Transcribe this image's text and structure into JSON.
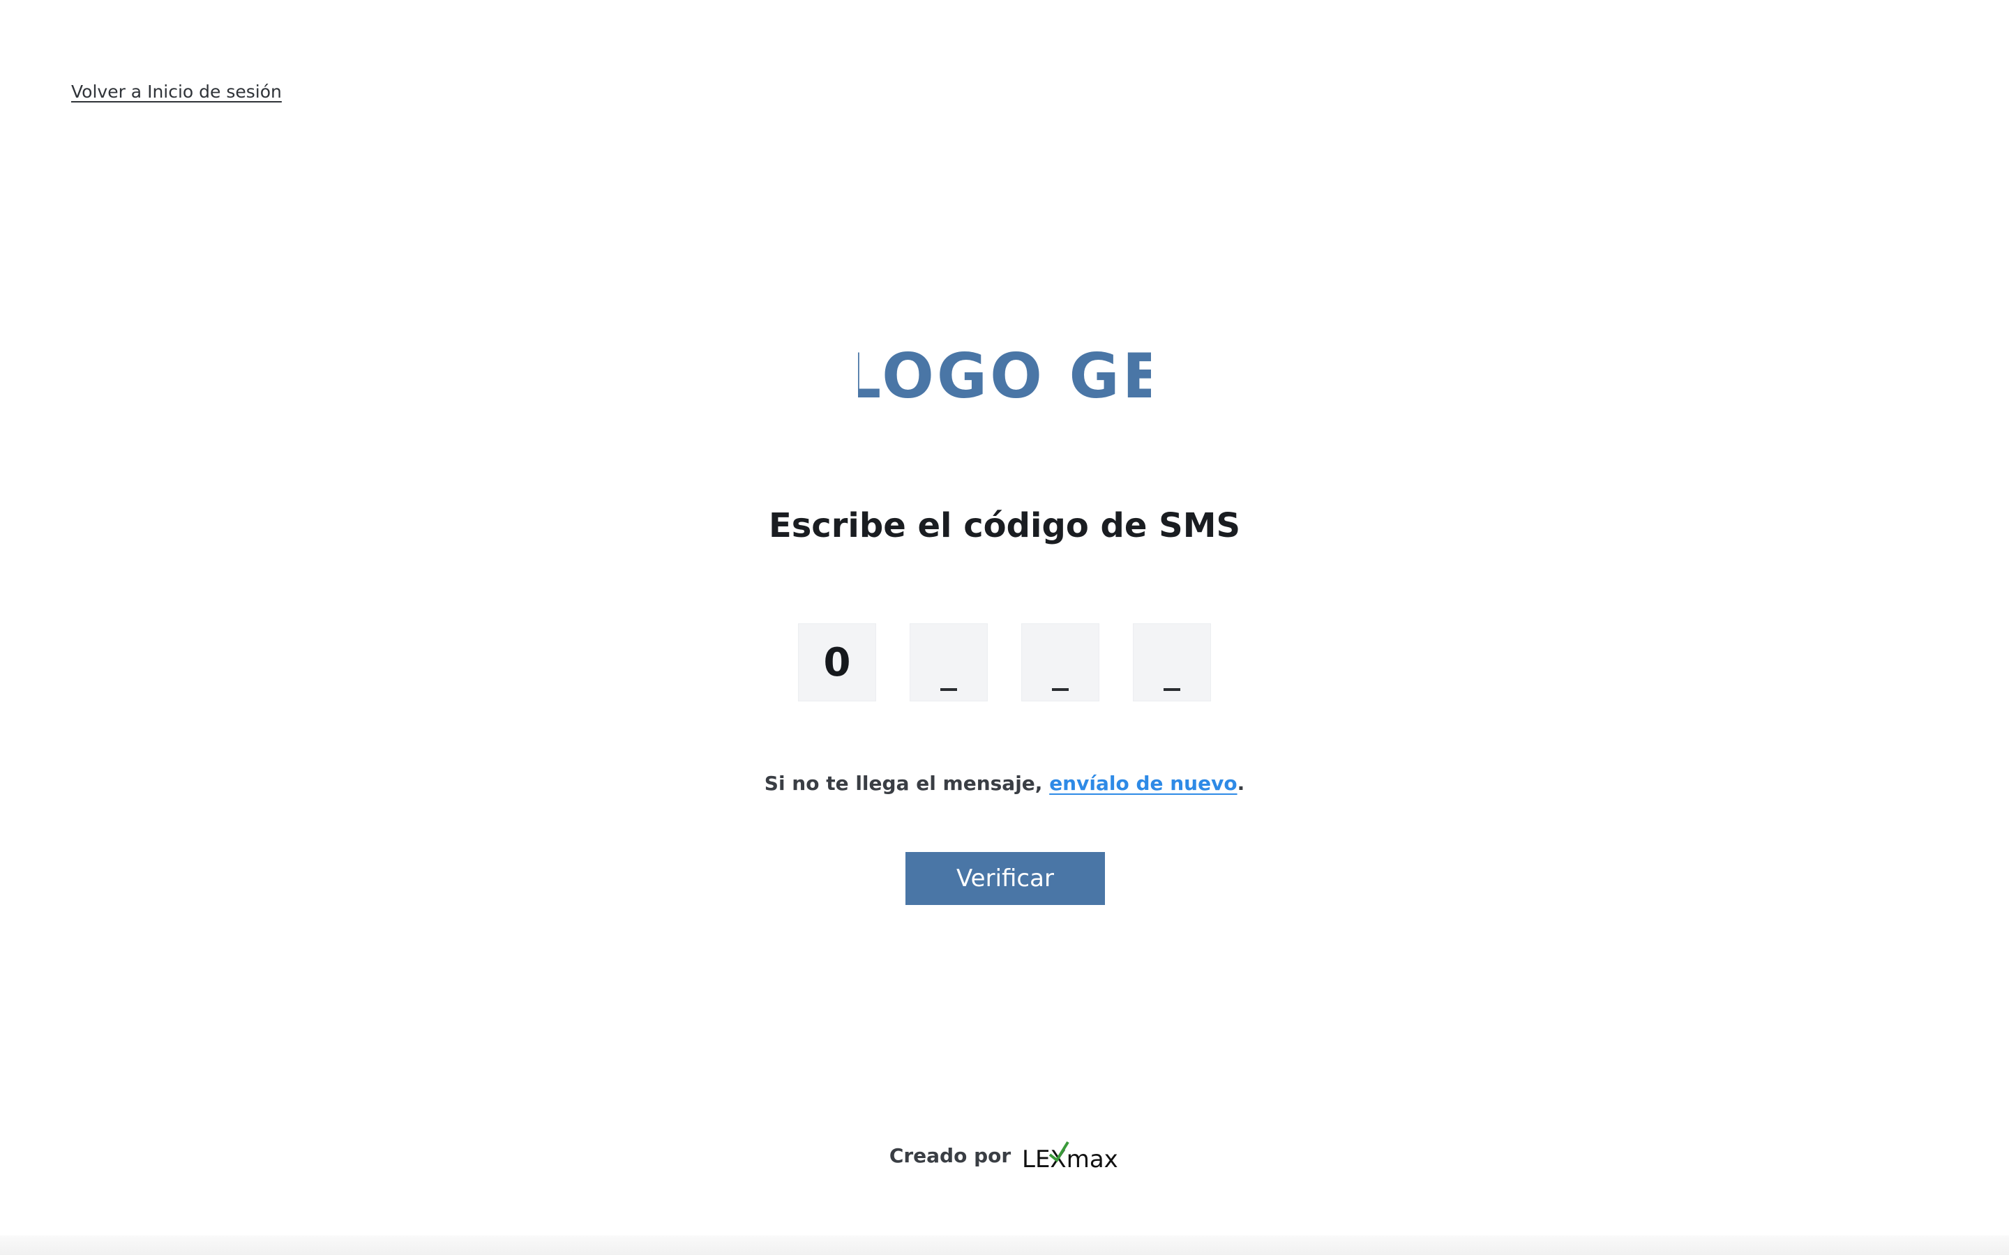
{
  "back_link": {
    "label": "Volver a Inicio de sesión"
  },
  "logo": {
    "text": "LOGO GE",
    "color": "#4a76a6"
  },
  "title": "Escribe el código de SMS",
  "code_inputs": [
    {
      "value": "0"
    },
    {
      "value": ""
    },
    {
      "value": ""
    },
    {
      "value": ""
    }
  ],
  "resend": {
    "prefix": "Si no te llega el mensaje, ",
    "link_label": "envíalo de nuevo",
    "suffix": "."
  },
  "verify_button": {
    "label": "Verificar",
    "color": "#4a76a6"
  },
  "footer": {
    "label": "Creado por",
    "brand_text": "LEXmax",
    "brand_check_color": "#3a9a3a"
  },
  "colors": {
    "accent": "#4a76a6",
    "link": "#2e8ae6",
    "input_bg": "#f3f4f6"
  }
}
